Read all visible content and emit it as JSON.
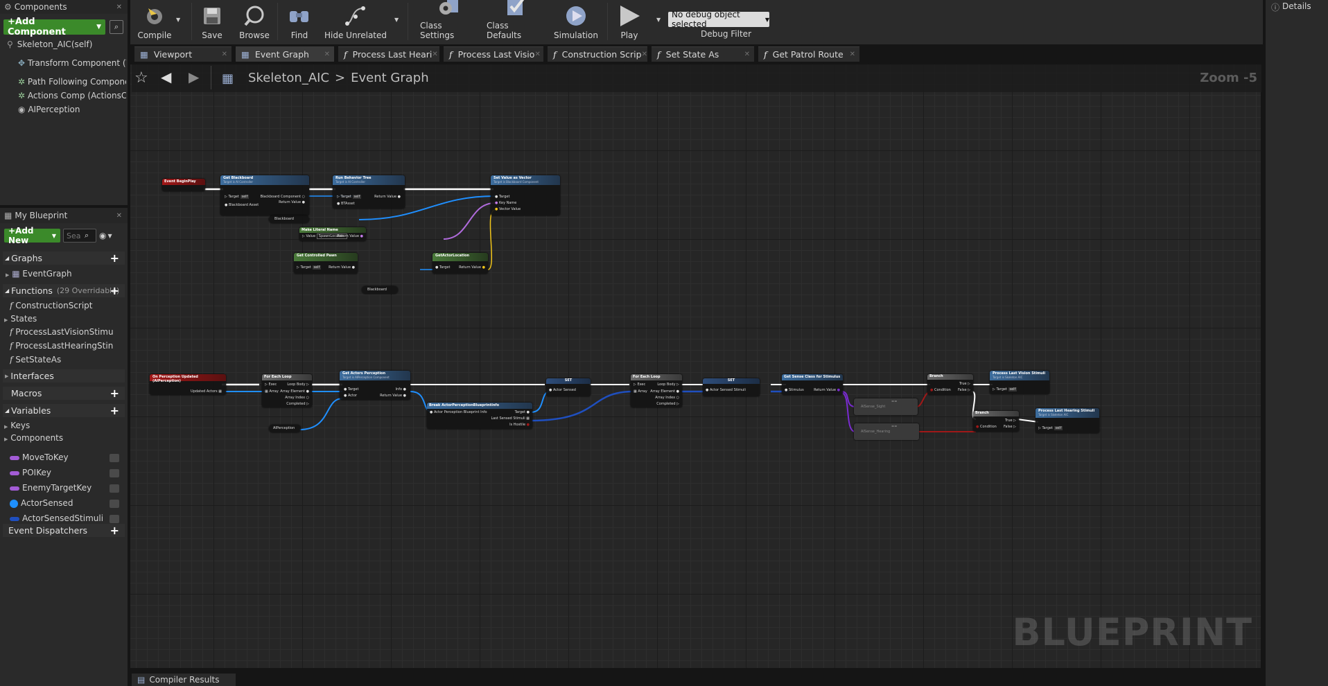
{
  "components_panel": {
    "tab_label": "Components",
    "add_component_label": "+Add Component",
    "self_item": "Skeleton_AIC(self)",
    "items": [
      "Transform Component (T",
      "Path Following Compone",
      "Actions Comp (ActionsCo",
      "AIPerception"
    ]
  },
  "my_blueprint": {
    "tab_label": "My Blueprint",
    "add_new_label": "+Add New",
    "search_placeholder": "Sea",
    "graphs_label": "Graphs",
    "graphs_items": [
      "EventGraph"
    ],
    "functions_label": "Functions",
    "functions_count": "(29 Overridable)",
    "functions_items": [
      "ConstructionScript"
    ],
    "states_label": "States",
    "states_items": [
      "ProcessLastVisionStimu",
      "ProcessLastHearingStin",
      "SetStateAs"
    ],
    "interfaces_label": "Interfaces",
    "macros_label": "Macros",
    "variables_label": "Variables",
    "keys_label": "Keys",
    "components_label": "Components",
    "variables": [
      {
        "name": "MoveToKey",
        "color": "#a35cd6"
      },
      {
        "name": "POIKey",
        "color": "#a35cd6"
      },
      {
        "name": "EnemyTargetKey",
        "color": "#a35cd6"
      },
      {
        "name": "ActorSensed",
        "color": "#1e90ff"
      },
      {
        "name": "ActorSensedStimuli",
        "color": "#1f4fbf"
      }
    ],
    "event_dispatchers_label": "Event Dispatchers"
  },
  "toolbar": {
    "compile": "Compile",
    "save": "Save",
    "browse": "Browse",
    "find": "Find",
    "hide_unrelated": "Hide Unrelated",
    "class_settings": "Class Settings",
    "class_defaults": "Class Defaults",
    "simulation": "Simulation",
    "play": "Play",
    "debug_select": "No debug object selected",
    "debug_filter": "Debug Filter"
  },
  "details_tab": "Details",
  "tabs": [
    "Viewport",
    "Event Graph",
    "Process Last Heari",
    "Process Last Visio",
    "Construction Scrip",
    "Set State As",
    "Get Patrol Route"
  ],
  "breadcrumb": {
    "root": "Skeleton_AIC",
    "separator": ">",
    "current": "Event Graph"
  },
  "zoom": "Zoom -5",
  "watermark": "BLUEPRINT",
  "compiler_results": "Compiler Results",
  "nodes": {
    "begin_play": "Event BeginPlay",
    "get_blackboard": "Get Blackboard",
    "get_blackboard_sub": "Target is AI Controller",
    "gb_target": "Target",
    "gb_self": "self",
    "gb_asset": "Blackboard Asset",
    "gb_comp": "Blackboard Component",
    "gb_ret": "Return Value",
    "run_bt": "Run Behavior Tree",
    "run_bt_sub": "Target is AI Controller",
    "rb_target": "Target",
    "rb_self": "self",
    "rb_asset": "BTAsset",
    "rb_ret": "Return Value",
    "set_vector": "Set Value as Vector",
    "set_vector_sub": "Target is Blackboard Component",
    "sv_target": "Target",
    "sv_key": "Key Name",
    "sv_value": "Vector Value",
    "blackboard_var": "Blackboard",
    "make_literal": "Make Literal Name",
    "ml_value": "Value",
    "ml_text": "SpawnLocation",
    "ml_ret": "Return Value",
    "get_pawn": "Get Controlled Pawn",
    "gp_target": "Target",
    "gp_self": "self",
    "gp_ret": "Return Value",
    "get_loc": "GetActorLocation",
    "gl_target": "Target",
    "gl_ret": "Return Value",
    "blackboard_var2": "Blackboard",
    "on_perception": "On Perception Updated (AIPerception)",
    "op_updated": "Updated Actors",
    "foreach1": "For Each Loop",
    "fe_exec": "Exec",
    "fe_body": "Loop Body",
    "fe_array": "Array",
    "fe_elem": "Array Element",
    "fe_index": "Array Index",
    "fe_done": "Completed",
    "aiperception_var": "AIPerception",
    "get_actors_perc": "Get Actors Perception",
    "gap_sub": "Target is AIPerception Component",
    "gap_target": "Target",
    "gap_actor": "Actor",
    "gap_info": "Info",
    "gap_ret": "Return Value",
    "break_info": "Break ActorPerceptionBlueprintInfo",
    "bi_in": "Actor Perception Blueprint Info",
    "bi_target": "Target",
    "bi_last": "Last Sensed Stimuli",
    "bi_hostile": "Is Hostile",
    "set1": "SET",
    "set1_pin": "Actor Sensed",
    "foreach2": "For Each Loop",
    "set2": "SET",
    "set2_pin": "Actor Sensed Stimuli",
    "get_sense": "Get Sense Class for Stimulus",
    "gs_stim": "Stimulus",
    "gs_ret": "Return Value",
    "branch1": "Branch",
    "br_cond": "Condition",
    "br_true": "True",
    "br_false": "False",
    "branch2": "Branch",
    "proc_vision": "Process Last Vision Stimuli",
    "pv_sub": "Target is Skeleton AIC",
    "pv_target": "Target",
    "pv_self": "self",
    "proc_hearing": "Process Last Hearing Stimuli",
    "ph_sub": "Target is Skeleton AIC",
    "ph_target": "Target",
    "ph_self": "self",
    "eq1_a": "AISense_Sight",
    "eq2_a": "AISense_Hearing"
  }
}
